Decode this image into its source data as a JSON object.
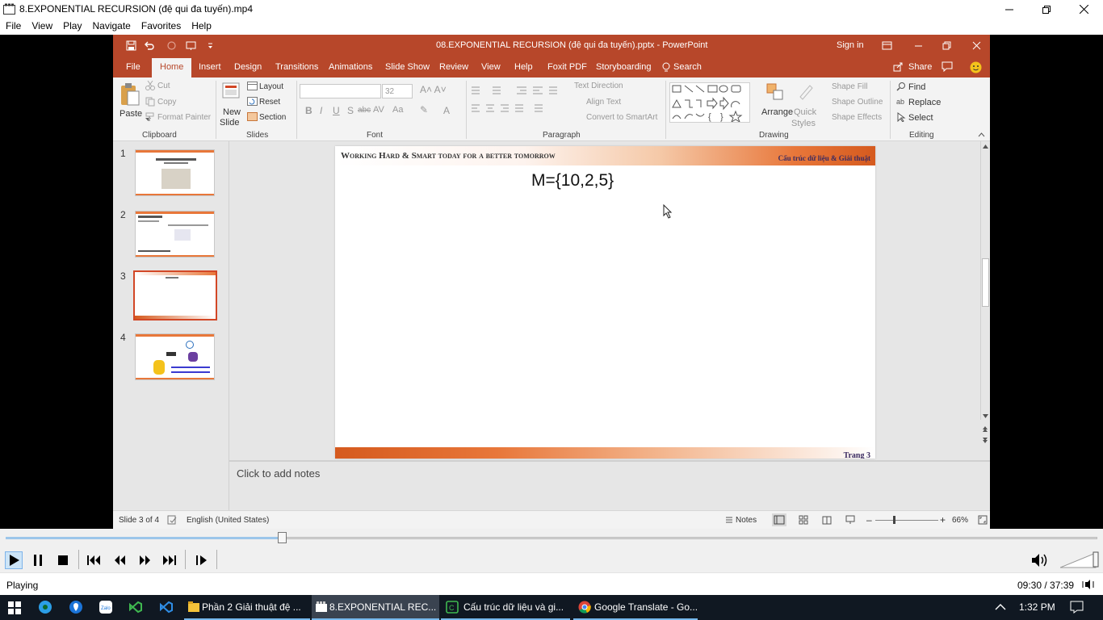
{
  "player": {
    "title": "8.EXPONENTIAL RECURSION (đệ qui đa tuyến).mp4",
    "menu": [
      "File",
      "View",
      "Play",
      "Navigate",
      "Favorites",
      "Help"
    ],
    "status": "Playing",
    "time": "09:30 / 37:39",
    "progress_fraction": 0.253,
    "volume_fraction": 1.0
  },
  "ppt": {
    "doc_title": "08.EXPONENTIAL RECURSION (đệ qui đa tuyến).pptx  -  PowerPoint",
    "sign_in": "Sign in",
    "tabs": [
      "File",
      "Home",
      "Insert",
      "Design",
      "Transitions",
      "Animations",
      "Slide Show",
      "Review",
      "View",
      "Help",
      "Foxit PDF",
      "Storyboarding"
    ],
    "search": "Search",
    "share": "Share",
    "ribbon": {
      "clipboard": {
        "paste": "Paste",
        "cut": "Cut",
        "copy": "Copy",
        "format_painter": "Format Painter",
        "label": "Clipboard"
      },
      "slides": {
        "new_slide": "New",
        "new_slide2": "Slide",
        "layout": "Layout",
        "reset": "Reset",
        "section": "Section",
        "label": "Slides"
      },
      "font": {
        "size": "32",
        "label": "Font"
      },
      "paragraph": {
        "text_direction": "Text Direction",
        "align_text": "Align Text",
        "convert": "Convert to SmartArt",
        "label": "Paragraph"
      },
      "drawing": {
        "arrange": "Arrange",
        "quick": "Quick",
        "styles": "Styles",
        "shape_fill": "Shape Fill",
        "shape_outline": "Shape Outline",
        "shape_effects": "Shape Effects",
        "label": "Drawing"
      },
      "editing": {
        "find": "Find",
        "replace": "Replace",
        "select": "Select",
        "label": "Editing"
      }
    },
    "slide_numbers": [
      "1",
      "2",
      "3",
      "4"
    ],
    "slide": {
      "header_left": "Working Hard & Smart today for a better tomorrow",
      "header_right": "Cấu trúc dữ liệu & Giải thuật",
      "content": "M={10,2,5}",
      "footer": "Trang 3"
    },
    "notes_placeholder": "Click to add notes",
    "statusbar": {
      "slide_of": "Slide 3 of 4",
      "language": "English (United States)",
      "notes": "Notes",
      "zoom": "66%"
    }
  },
  "taskbar": {
    "items": [
      {
        "label": "Phần 2 Giải thuật đệ ..."
      },
      {
        "label": "8.EXPONENTIAL REC..."
      },
      {
        "label": "Cấu trúc dữ liệu và gi..."
      },
      {
        "label": "Google Translate - Go..."
      }
    ],
    "clock": "1:32 PM"
  },
  "colors": {
    "ppt_accent": "#b7472a",
    "slide_orange": "#e8773a",
    "taskbar": "#101822"
  }
}
